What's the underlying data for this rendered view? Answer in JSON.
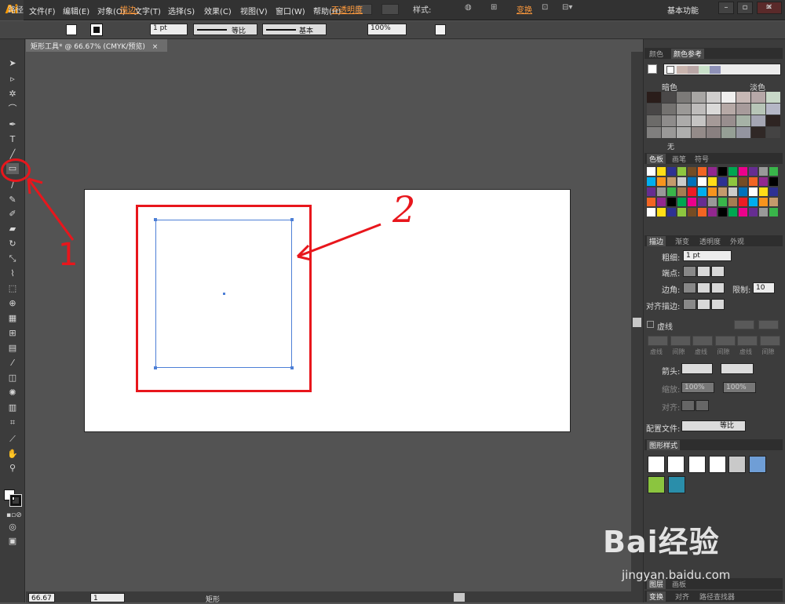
{
  "app": {
    "logo": "Ai",
    "workspace": "基本功能"
  },
  "menu": [
    "文件(F)",
    "编辑(E)",
    "对象(O)",
    "文字(T)",
    "选择(S)",
    "效果(C)",
    "视图(V)",
    "窗口(W)",
    "帮助(H)"
  ],
  "control": {
    "selection_label": "路径",
    "stroke_label": "描边:",
    "stroke_weight": "1 pt",
    "profile": "等比",
    "brush": "基本",
    "opacity_label": "不透明度",
    "opacity_value": "100%",
    "style_label": "样式:",
    "transform_label": "变换"
  },
  "document": {
    "tab_title": "矩形工具* @ 66.67% (CMYK/预览)",
    "close": "×"
  },
  "status": {
    "zoom": "66.67",
    "page": "1",
    "tool": "矩形"
  },
  "annotations": {
    "label1": "1",
    "label2": "2"
  },
  "panels": {
    "color": {
      "tabs": [
        "颜色",
        "颜色参考"
      ],
      "dark": "暗色",
      "light": "淡色",
      "none": "无"
    },
    "swatches": {
      "tabs": [
        "色板",
        "画笔",
        "符号"
      ]
    },
    "stroke": {
      "tabs": [
        "描边",
        "渐变",
        "透明度",
        "外观"
      ],
      "weight_label": "粗细:",
      "weight_value": "1 pt",
      "cap_label": "端点:",
      "corner_label": "边角:",
      "limit_label": "限制:",
      "limit_value": "10",
      "align_label": "对齐描边:",
      "dashed_label": "虚线",
      "dash_labels": [
        "虚线",
        "间隙",
        "虚线",
        "间隙",
        "虚线",
        "间隙"
      ],
      "arrow_label": "箭头:",
      "scale_label": "缩放:",
      "scale_values": [
        "100%",
        "100%"
      ],
      "align2_label": "对齐:",
      "profile_label": "配置文件:",
      "profile_value": "等比"
    },
    "graphic_styles": {
      "title": "图形样式"
    },
    "bottom_tabs": [
      "图层",
      "画板"
    ],
    "bottom_tabs2": [
      "变换",
      "对齐",
      "路径查找器"
    ]
  },
  "watermark": {
    "main": "Bai经验",
    "url": "jingyan.baidu.com"
  },
  "colors": {
    "accent": "#ff9a00",
    "annotation": "#e8161c",
    "selection": "#4d7fd6"
  }
}
